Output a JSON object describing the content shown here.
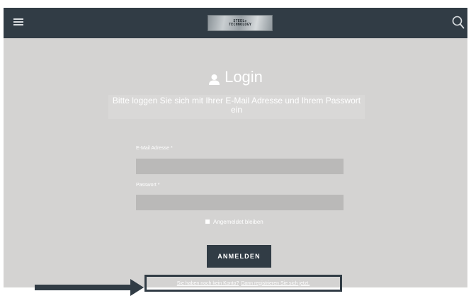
{
  "header": {
    "logo_line1": "STEEL+",
    "logo_line2": "TECHNOLOGY"
  },
  "login": {
    "title": "Login",
    "subtitle": "Bitte loggen Sie sich mit Ihrer E-Mail Adresse und Ihrem Passwort ein",
    "email_label": "E-Mail Adresse *",
    "email_value": "",
    "password_label": "Passwort *",
    "password_value": "",
    "remember_label": "Angemeldet bleiben",
    "submit_label": "ANMELDEN",
    "no_account_text": "Sie haben noch kein Konto?",
    "register_link": "Dann registrieren Sie sich jetzt."
  },
  "colors": {
    "header_bg": "#313c45",
    "page_bg": "#d4d3d2",
    "input_bg": "#bab9b8",
    "button_bg": "#313c45"
  },
  "icons": [
    "menu-icon",
    "search-icon",
    "user-icon",
    "arrow-icon"
  ]
}
